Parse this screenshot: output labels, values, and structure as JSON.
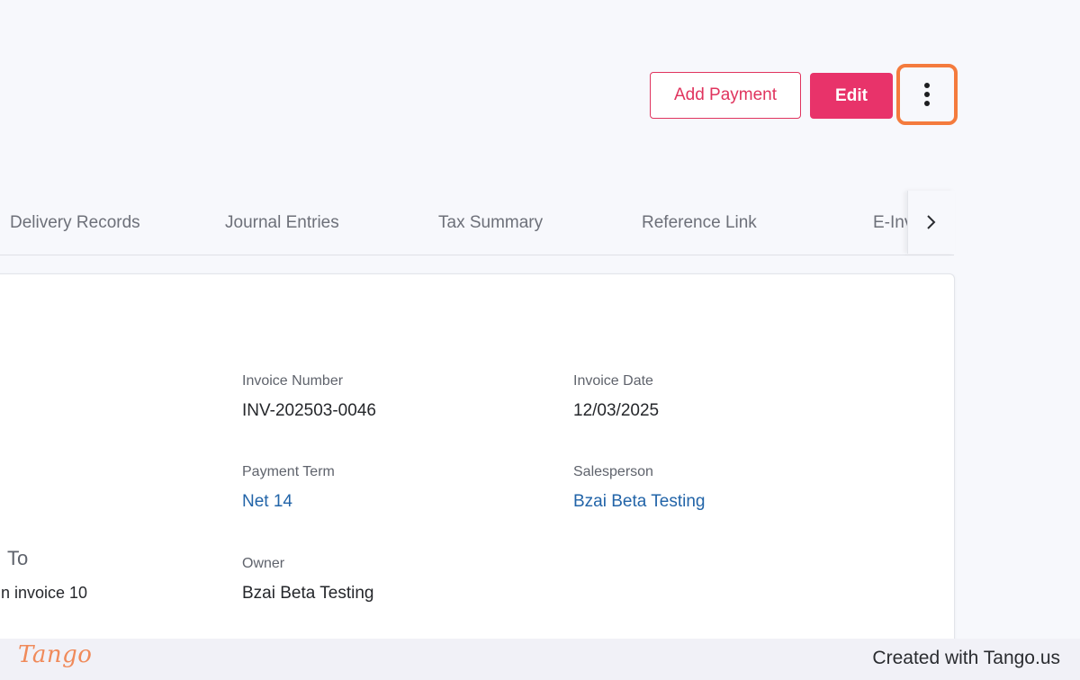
{
  "header": {
    "add_payment_label": "Add Payment",
    "edit_label": "Edit",
    "more_icon": "vertical-ellipsis-icon"
  },
  "tabs": [
    {
      "label": "Delivery Records"
    },
    {
      "label": "Journal Entries"
    },
    {
      "label": "Tax Summary"
    },
    {
      "label": "Reference Link"
    },
    {
      "label": "E-Inv"
    }
  ],
  "tab_scroll_icon": "chevron-right-icon",
  "invoice": {
    "invoice_number_label": "Invoice Number",
    "invoice_number": "INV-202503-0046",
    "invoice_date_label": "Invoice Date",
    "invoice_date": "12/03/2025",
    "payment_term_label": "Payment Term",
    "payment_term": "Net 14",
    "salesperson_label": "Salesperson",
    "salesperson": "Bzai Beta Testing",
    "owner_label": "Owner",
    "owner": "Bzai Beta Testing",
    "left_heading_fragment": "To",
    "left_text_fragment": "n invoice 10"
  },
  "footer": {
    "brand": "Tango",
    "credit": "Created with Tango.us"
  },
  "colors": {
    "accent": "#e8336a",
    "highlight": "#f47b3d",
    "link": "#2264a8",
    "brand": "#f08a5a"
  }
}
